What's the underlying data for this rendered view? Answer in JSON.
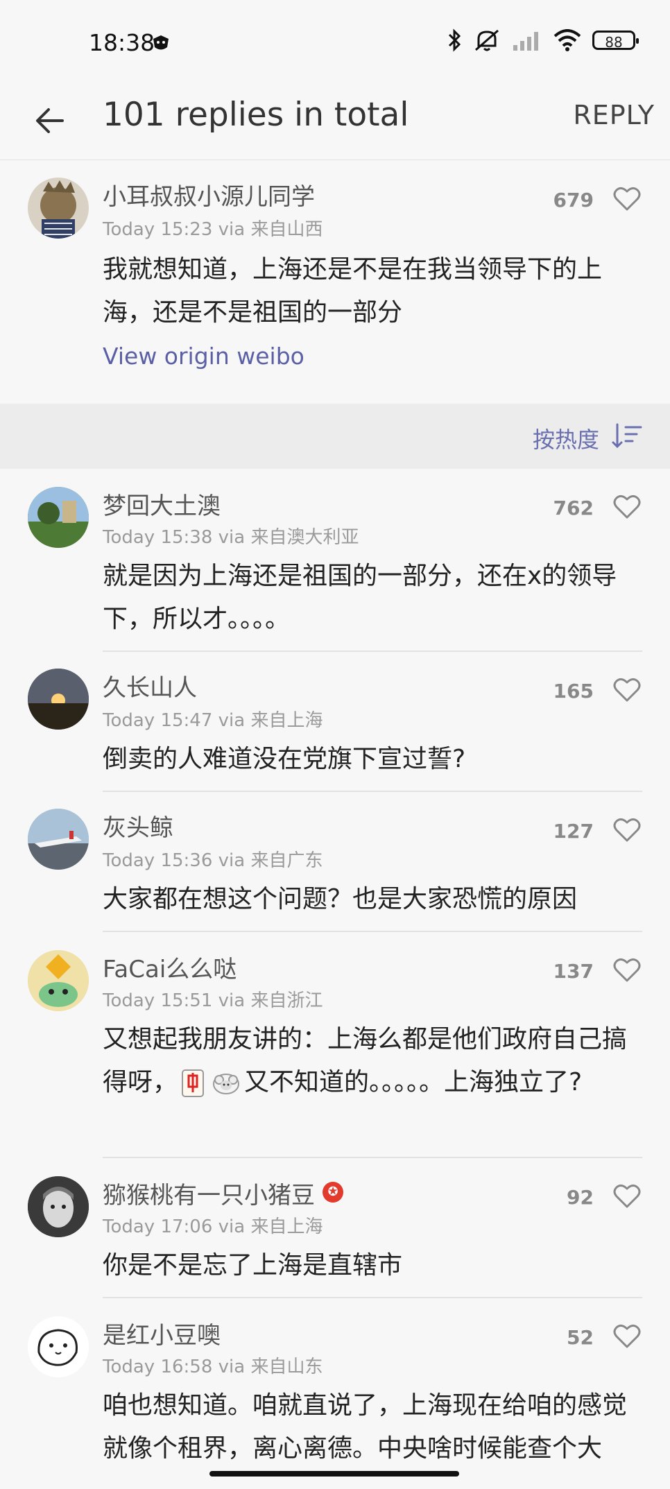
{
  "status": {
    "time": "18:38",
    "battery": "88"
  },
  "header": {
    "title": "101 replies in total",
    "reply_label": "REPLY"
  },
  "origin_post": {
    "user": "小耳叔叔小源儿同学",
    "meta": "Today 15:23 via 来自山西",
    "likes": "679",
    "text": "我就想知道，上海还是不是在我当领导下的上海，还是不是祖国的一部分",
    "view_origin": "View origin weibo"
  },
  "sort": {
    "label": "按热度"
  },
  "comments": [
    {
      "user": "梦回大土澳",
      "meta": "Today 15:38 via 来自澳大利亚",
      "likes": "762",
      "text": "就是因为上海还是祖国的一部分，还在x的领导下，所以才。。。。"
    },
    {
      "user": "久长山人",
      "meta": "Today 15:47 via 来自上海",
      "likes": "165",
      "text": "倒卖的人难道没在党旗下宣过誓?"
    },
    {
      "user": "灰头鲸",
      "meta": "Today 15:36 via 来自广东",
      "likes": "127",
      "text": "大家都在想这个问题？也是大家恐慌的原因"
    },
    {
      "user": "FaCai么么哒",
      "meta": "Today 15:51 via 来自浙江",
      "likes": "137",
      "text_a": "又想起我朋友讲的：上海么都是他们政府自己搞得呀，",
      "text_b": "又不知道的。。。。。上海独立了?"
    },
    {
      "user": "猕猴桃有一只小猪豆",
      "meta": "Today 17:06 via 来自上海",
      "likes": "92",
      "text": "你是不是忘了上海是直辖市"
    },
    {
      "user": "是红小豆噢",
      "meta": "Today 16:58 via 来自山东",
      "likes": "52",
      "text": "咱也想知道。咱就直说了，上海现在给咱的感觉就像个租界，离心离德。中央啥时候能查个大"
    }
  ]
}
